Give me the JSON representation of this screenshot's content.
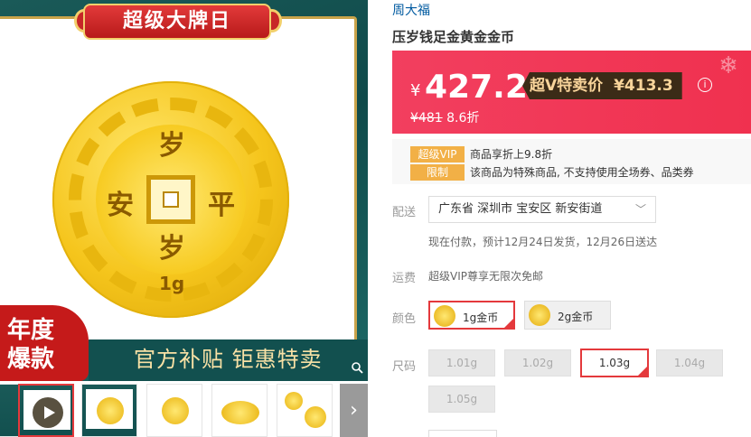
{
  "gallery": {
    "banner": "超级大牌日",
    "coin_chars": {
      "top": "岁",
      "left": "安",
      "right": "平",
      "bottom": "岁",
      "weight": "1g"
    },
    "badge": {
      "line1": "年度",
      "line2": "爆款"
    },
    "slogan": "官方补贴 钜惠特卖",
    "thumbnails": [
      {
        "kind": "video"
      },
      {
        "kind": "banner-coin"
      },
      {
        "kind": "coin"
      },
      {
        "kind": "oval-coin"
      },
      {
        "kind": "multi-coin"
      },
      {
        "kind": "partial"
      }
    ]
  },
  "product": {
    "brand": "周大福",
    "title": "压岁钱足金黄金金币"
  },
  "price": {
    "symbol": "¥",
    "current": "427.2",
    "vip_label": "超V特卖价",
    "vip_price": "¥413.3",
    "original": "¥481",
    "discount": "8.6折",
    "bg_color": "#f23f5f"
  },
  "promos": [
    {
      "tag": "超级VIP",
      "text": "商品享折上9.8折"
    },
    {
      "tag": "限制",
      "text": "该商品为特殊商品, 不支持使用全场券、品类券"
    }
  ],
  "delivery": {
    "label": "配送",
    "address": "广东省 深圳市 宝安区 新安街道",
    "note": "现在付款，预计12月24日发货，12月26日送达"
  },
  "freight": {
    "label": "运费",
    "text": "超级VIP尊享无限次免邮"
  },
  "colors": {
    "label": "颜色",
    "options": [
      {
        "label": "1g金币",
        "selected": true
      },
      {
        "label": "2g金币",
        "selected": false
      }
    ]
  },
  "sizes": {
    "label": "尺码",
    "options": [
      {
        "label": "1.01g",
        "selected": false
      },
      {
        "label": "1.02g",
        "selected": false
      },
      {
        "label": "1.03g",
        "selected": true
      },
      {
        "label": "1.04g",
        "selected": false
      },
      {
        "label": "1.05g",
        "selected": false
      }
    ]
  },
  "accent_color": "#e4393c"
}
